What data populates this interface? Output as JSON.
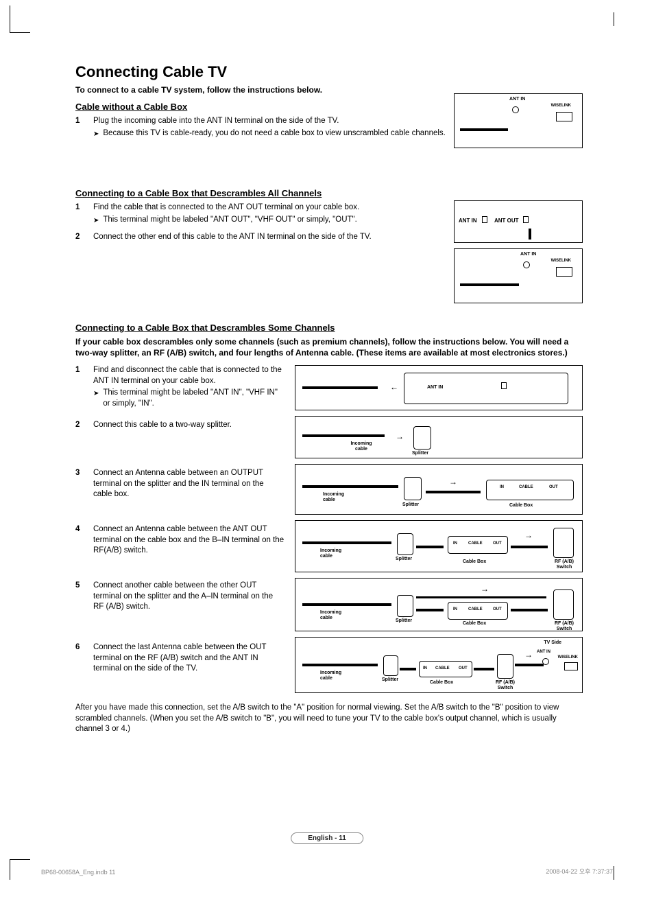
{
  "title": "Connecting Cable TV",
  "intro": "To connect to a cable TV system, follow the instructions below.",
  "section1": {
    "heading": "Cable without a Cable Box",
    "step1_num": "1",
    "step1_text": "Plug the incoming cable into the ANT IN terminal on the side of the TV.",
    "step1_sub": "Because this TV is cable-ready, you do not need a cable box to view unscrambled cable channels.",
    "dia": {
      "ant_in": "ANT IN",
      "wiselink": "WISELINK"
    }
  },
  "section2": {
    "heading": "Connecting to a Cable Box that Descrambles All Channels",
    "step1_num": "1",
    "step1_text": "Find the cable that is connected to the ANT OUT terminal on your cable box.",
    "step1_sub": "This terminal might be labeled \"ANT OUT\", \"VHF OUT\" or simply, \"OUT\".",
    "step2_num": "2",
    "step2_text": "Connect the other end of this cable to the ANT IN terminal on the side of the TV.",
    "dia1": {
      "ant_in": "ANT IN",
      "ant_out": "ANT OUT"
    },
    "dia2": {
      "ant_in": "ANT IN",
      "wiselink": "WISELINK"
    }
  },
  "section3": {
    "heading": "Connecting to a Cable Box that Descrambles Some Channels",
    "desc": " If your cable box descrambles only some channels (such as premium channels), follow the instructions below. You will need a two-way splitter, an RF (A/B) switch, and four lengths of Antenna cable. (These items are available at most electronics stores.)",
    "steps": [
      {
        "num": "1",
        "text": "Find and disconnect the cable that is connected to the ANT IN terminal on your cable box.",
        "sub": "This terminal might be labeled \"ANT IN\", \"VHF IN\" or simply, \"IN\"."
      },
      {
        "num": "2",
        "text": "Connect this cable to a two-way splitter."
      },
      {
        "num": "3",
        "text": "Connect an Antenna cable between an OUTPUT terminal on the splitter and the IN terminal on the cable box."
      },
      {
        "num": "4",
        "text": "Connect an Antenna cable between the ANT OUT terminal on the cable box and the B–IN terminal on the RF(A/B) switch."
      },
      {
        "num": "5",
        "text": "Connect another cable between the other OUT terminal on the splitter and the A–IN terminal on the RF (A/B) switch."
      },
      {
        "num": "6",
        "text": "Connect the last Antenna cable between the OUT terminal on the RF (A/B) switch and the ANT IN terminal on the side of the TV."
      }
    ],
    "dia_labels": {
      "ant_in": "ANT IN",
      "incoming_cable": "Incoming cable",
      "splitter": "Splitter",
      "cable_box": "Cable Box",
      "in": "IN",
      "cable": "CABLE",
      "out": "OUT",
      "rf_switch": "RF (A/B) Switch",
      "tv_side": "TV Side",
      "ant_in_small": "ANT IN",
      "wiselink": "WISELINK"
    },
    "after": "After you have made this connection, set the A/B switch to the \"A\" position for normal viewing. Set the A/B switch to the \"B\" position to view scrambled channels. (When you set the A/B switch to \"B\", you will need to tune your TV to the cable box's output channel, which is usually channel 3 or 4.)"
  },
  "page_badge": "English - 11",
  "footer_left": "BP68-00658A_Eng.indb   11",
  "footer_right": "2008-04-22   오후 7:37:37"
}
